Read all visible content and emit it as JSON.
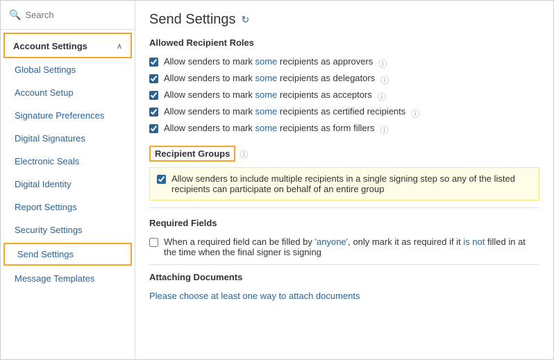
{
  "search": {
    "placeholder": "Search"
  },
  "sidebar": {
    "account_settings_label": "Account Settings",
    "items": [
      {
        "id": "global-settings",
        "label": "Global Settings"
      },
      {
        "id": "account-setup",
        "label": "Account Setup"
      },
      {
        "id": "signature-preferences",
        "label": "Signature Preferences"
      },
      {
        "id": "digital-signatures",
        "label": "Digital Signatures"
      },
      {
        "id": "electronic-seals",
        "label": "Electronic Seals"
      },
      {
        "id": "digital-identity",
        "label": "Digital Identity"
      },
      {
        "id": "report-settings",
        "label": "Report Settings"
      },
      {
        "id": "security-settings",
        "label": "Security Settings"
      },
      {
        "id": "send-settings",
        "label": "Send Settings",
        "active": true
      },
      {
        "id": "message-templates",
        "label": "Message Templates"
      }
    ]
  },
  "main": {
    "title": "Send Settings",
    "sections": {
      "allowed_recipient_roles": {
        "title": "Allowed Recipient Roles",
        "checkboxes": [
          {
            "id": "approvers",
            "checked": true,
            "text_before": "Allow senders to mark ",
            "highlighted": "some",
            "text_after": " recipients as approvers",
            "has_help": true
          },
          {
            "id": "delegators",
            "checked": true,
            "text_before": "Allow senders to mark ",
            "highlighted": "some",
            "text_after": " recipients as delegators",
            "has_help": true
          },
          {
            "id": "acceptors",
            "checked": true,
            "text_before": "Allow senders to mark ",
            "highlighted": "some",
            "text_after": " recipients as acceptors",
            "has_help": true
          },
          {
            "id": "certified",
            "checked": true,
            "text_before": "Allow senders to mark ",
            "highlighted": "some",
            "text_after": " recipients as certified recipients",
            "has_help": true
          },
          {
            "id": "form-fillers",
            "checked": true,
            "text_before": "Allow senders to mark ",
            "highlighted": "some",
            "text_after": " recipients as form fillers",
            "has_help": true
          }
        ]
      },
      "recipient_groups": {
        "title": "Recipient Groups",
        "has_help": true,
        "checkbox": {
          "checked": true,
          "text": "Allow senders to include multiple recipients in a single signing step so any of the listed recipients can participate on behalf of an entire group"
        }
      },
      "required_fields": {
        "title": "Required Fields",
        "checkbox": {
          "checked": false,
          "text_before": "When a required field can be filled by ",
          "highlighted1": "'anyone'",
          "text_middle": ", only mark it as required if it ",
          "highlighted2": "is not",
          "text_after": " filled in at the time when the final signer is signing"
        }
      },
      "attaching_documents": {
        "title": "Attaching Documents",
        "subtitle": "Please choose at least one way to attach documents"
      }
    }
  },
  "icons": {
    "search": "🔍",
    "refresh": "↻",
    "help": "?",
    "chevron_up": "∧"
  }
}
